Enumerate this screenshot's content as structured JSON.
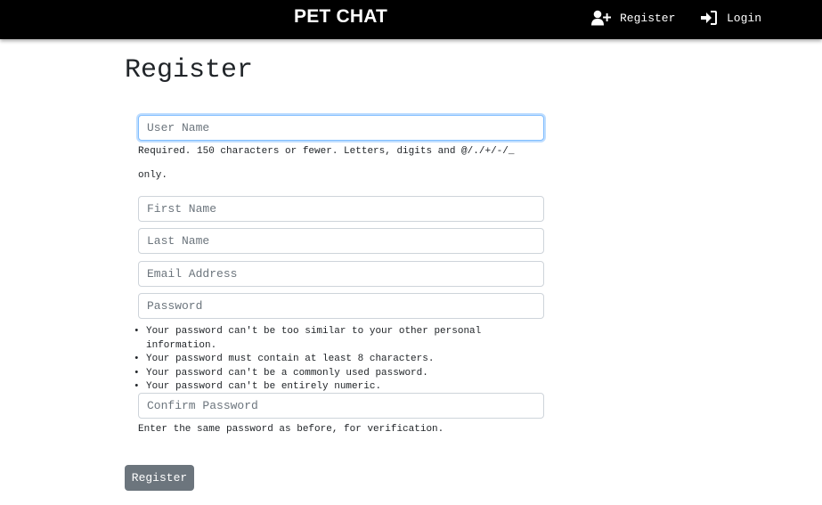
{
  "navbar": {
    "brand": "PET CHAT",
    "register_label": "Register",
    "login_label": "Login"
  },
  "page": {
    "title": "Register"
  },
  "form": {
    "username": {
      "placeholder": "User Name",
      "value": ""
    },
    "username_help_line1": "Required. 150 characters or fewer. Letters, digits and @/./+/-/_",
    "username_help_line2": "only.",
    "first_name": {
      "placeholder": "First Name",
      "value": ""
    },
    "last_name": {
      "placeholder": "Last Name",
      "value": ""
    },
    "email": {
      "placeholder": "Email Address",
      "value": ""
    },
    "password": {
      "placeholder": "Password",
      "value": ""
    },
    "password_rules": [
      "Your password can't be too similar to your other personal information.",
      "Your password must contain at least 8 characters.",
      "Your password can't be a commonly used password.",
      "Your password can't be entirely numeric."
    ],
    "confirm_password": {
      "placeholder": "Confirm Password",
      "value": ""
    },
    "confirm_help": "Enter the same password as before, for verification.",
    "submit_label": "Register"
  },
  "colors": {
    "navbar_bg": "#000000",
    "button_bg": "#6c757d",
    "focus_border": "#80bdff"
  },
  "icons": {
    "register": "user-plus-icon",
    "login": "sign-in-icon"
  }
}
